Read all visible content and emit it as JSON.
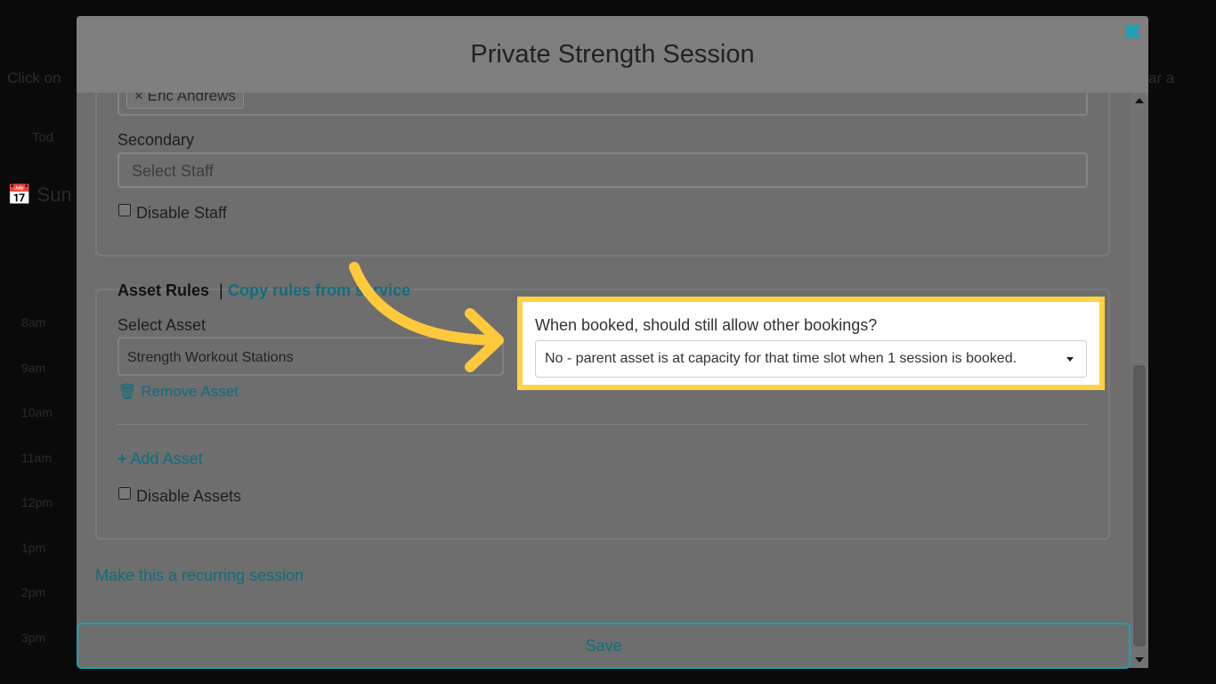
{
  "modal": {
    "title": "Private Strength Session",
    "close_icon": "close-icon"
  },
  "staff": {
    "selected_tag": "× Eric Andrews",
    "secondary_label": "Secondary",
    "secondary_placeholder": "Select Staff",
    "disable_label": "Disable Staff"
  },
  "assets": {
    "heading": "Asset Rules",
    "separator": "|",
    "copy_link": "Copy rules from service",
    "select_label": "Select Asset",
    "selected_asset": "Strength Workout Stations",
    "remove_label": "Remove Asset",
    "add_label": "Add Asset",
    "disable_label": "Disable Assets",
    "booking_question": "When booked, should still allow other bookings?",
    "booking_value": "No - parent asset is at capacity for that time slot when 1 session is booked."
  },
  "recurring_link": "Make this a recurring session",
  "save_label": "Save",
  "colors": {
    "accent": "#17a3b8",
    "highlight": "#ffd343",
    "arrow": "#ffc93c"
  },
  "background": {
    "instruction_left": "Click on",
    "instruction_right": "ar a",
    "tab": "Tod",
    "date_prefix": "Sun",
    "hours": [
      "8am",
      "9am",
      "10am",
      "11am",
      "12pm",
      "1pm",
      "2pm",
      "3pm"
    ]
  }
}
